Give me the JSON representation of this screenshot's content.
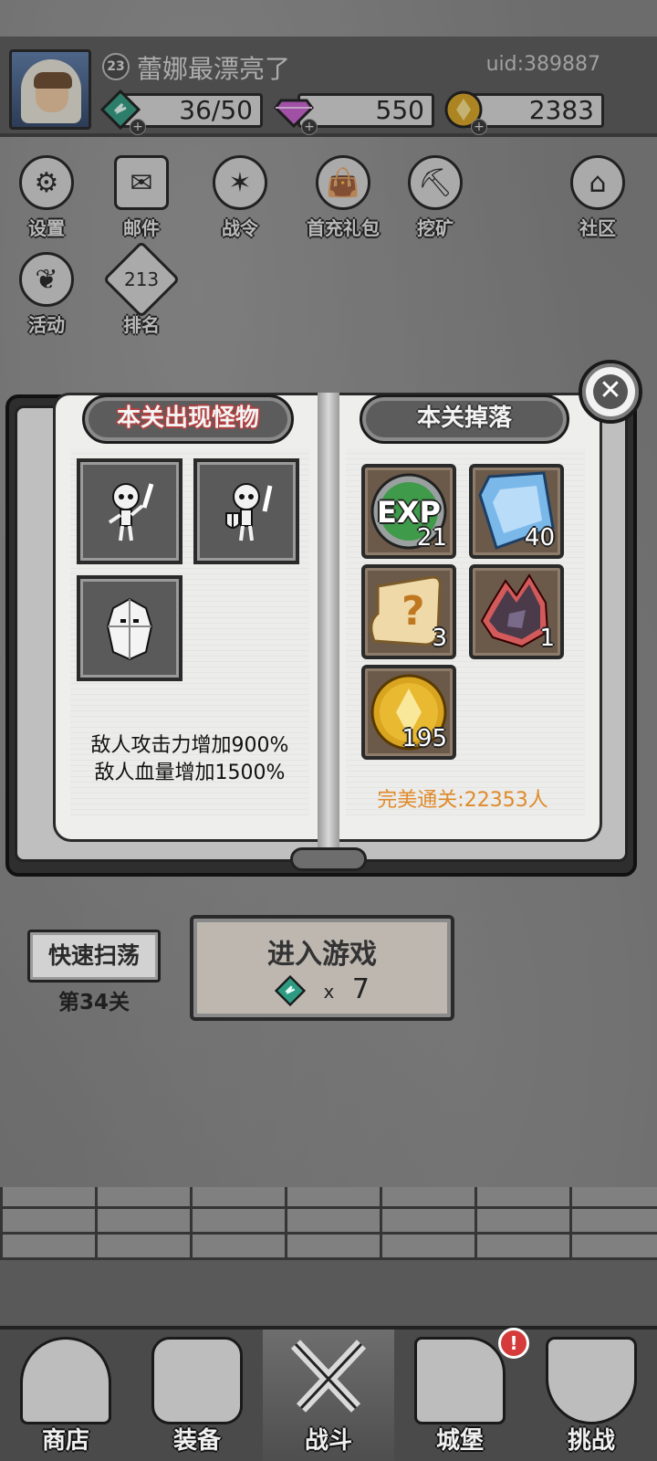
{
  "player": {
    "level": "23",
    "name": "蕾娜最漂亮了",
    "uid": "uid:389887"
  },
  "resources": {
    "stamina": "36/50",
    "gems": "550",
    "gold": "2383"
  },
  "menu": [
    {
      "label": "设置",
      "icon": "gear-icon"
    },
    {
      "label": "邮件",
      "icon": "mail-icon"
    },
    {
      "label": "战令",
      "icon": "battle-pass-icon"
    },
    {
      "label": "首充礼包",
      "icon": "gift-bag-icon"
    },
    {
      "label": "挖矿",
      "icon": "mining-icon"
    },
    {
      "label": "社区",
      "icon": "community-icon"
    },
    {
      "label": "活动",
      "icon": "event-icon"
    },
    {
      "label": "排名",
      "icon": "ranking-icon"
    }
  ],
  "book": {
    "monsters_title": "本关出现怪物",
    "drops_title": "本关掉落",
    "monsters": [
      "skeleton-swordsman",
      "skeleton-shield-soldier",
      "rock-golem"
    ],
    "buffs": [
      "敌人攻击力增加900%",
      "敌人血量增加1500%"
    ],
    "drops": [
      {
        "item": "exp-orb",
        "label": "EXP",
        "count": "21"
      },
      {
        "item": "blue-crystal",
        "count": "40"
      },
      {
        "item": "mystery-scroll",
        "count": "3"
      },
      {
        "item": "dark-ore",
        "count": "1"
      },
      {
        "item": "gold-coin",
        "count": "195"
      }
    ],
    "perfect_clear": "完美通关:22353人"
  },
  "actions": {
    "sweep_label": "快速扫荡",
    "stage_label": "第34关",
    "enter_label": "进入游戏",
    "enter_cost_x": "x",
    "enter_cost": "7"
  },
  "nav": [
    {
      "label": "商店",
      "icon": "shop-icon"
    },
    {
      "label": "装备",
      "icon": "equipment-icon"
    },
    {
      "label": "战斗",
      "icon": "battle-icon",
      "active": true
    },
    {
      "label": "城堡",
      "icon": "castle-icon"
    },
    {
      "label": "挑战",
      "icon": "challenge-icon"
    }
  ],
  "notification_mark": "!",
  "colors": {
    "accent_orange": "#e08a2a",
    "stamina_gem": "#2f9a82",
    "premium_gem": "#c85fd0",
    "gold": "#d9a521",
    "alert_red": "#d63b3b"
  }
}
